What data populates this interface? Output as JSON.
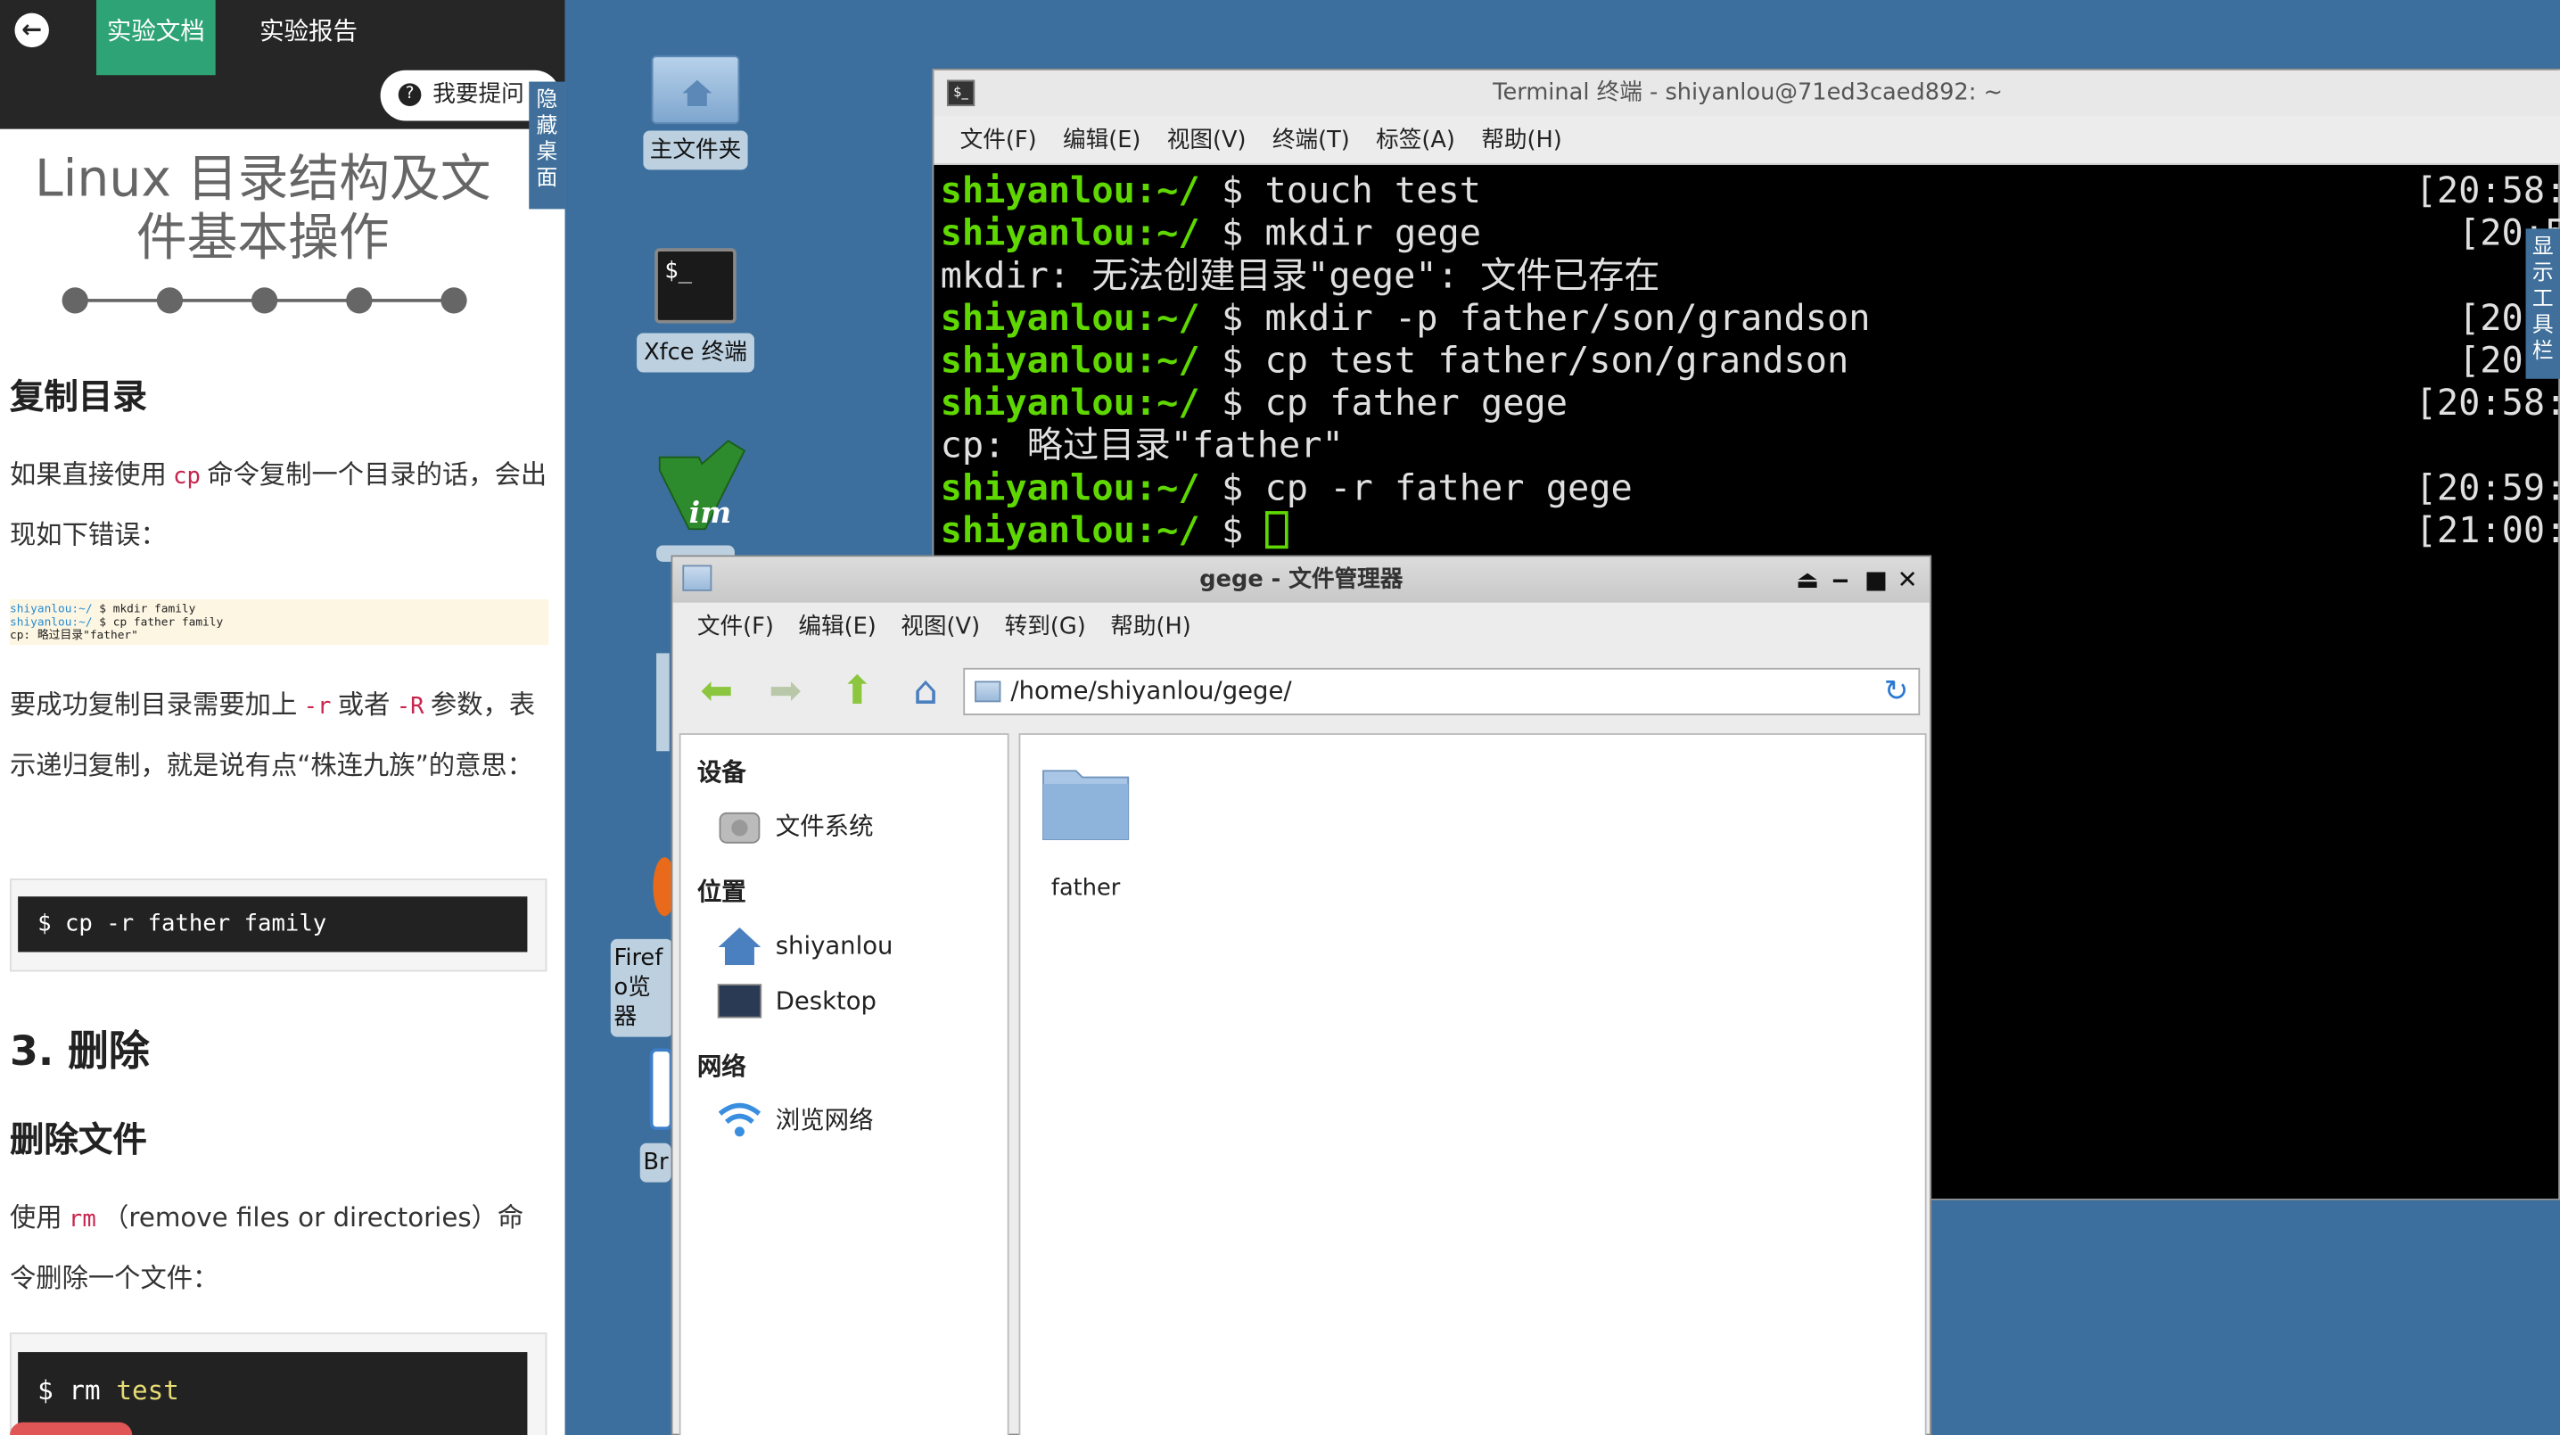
{
  "left_panel": {
    "header": {
      "tab_docs": "实验文档",
      "tab_report": "实验报告",
      "ask_button": "我要提问",
      "hide_desktop": "隐藏桌面"
    },
    "title": "Linux 目录结构及文件基本操作",
    "section_copy_dir": "复制目录",
    "para1_a": "如果直接使用",
    "para1_code": "cp",
    "para1_b": "命令复制一个目录的话，会出现如下错误：",
    "mini_terminal": [
      {
        "prompt": "shiyanlou:~/",
        "cmd": " $ mkdir family"
      },
      {
        "prompt": "shiyanlou:~/",
        "cmd": " $ cp father family"
      },
      {
        "prompt": "",
        "cmd": "cp: 略过目录\"father\""
      }
    ],
    "para2_a": "要成功复制目录需要加上",
    "para2_code1": "-r",
    "para2_mid": "或者",
    "para2_code2": "-R",
    "para2_b": "参数，表示递归复制，就是说有点“株连九族”的意思：",
    "code1": "$ cp -r father family",
    "section_delete": "3. 删除",
    "section_delete_file": "删除文件",
    "para3_a": "使用",
    "para3_code": "rm",
    "para3_b": "（remove files or directories）命令删除一个文件：",
    "code2_prompt": "$ rm",
    "code2_arg": "test"
  },
  "desktop": {
    "icons": {
      "home_folder": "主文件夹",
      "xfce_terminal": "Xfce 终端",
      "firefox_partial": "Firefo览器",
      "br_partial": "Br"
    },
    "show_toolbar": "显示工具栏"
  },
  "terminal": {
    "title": "Terminal 终端 - shiyanlou@71ed3caed892: ~",
    "menu": [
      "文件(F)",
      "编辑(E)",
      "视图(V)",
      "终端(T)",
      "标签(A)",
      "帮助(H)"
    ],
    "lines": [
      {
        "prompt": "shiyanlou:~/",
        "text": " $ touch test",
        "time": "[20:58:"
      },
      {
        "prompt": "shiyanlou:~/",
        "text": " $ mkdir gege",
        "time": "[20:5"
      },
      {
        "prompt": "",
        "text": "mkdir: 无法创建目录\"gege\": 文件已存在",
        "time": ""
      },
      {
        "prompt": "shiyanlou:~/",
        "text": " $ mkdir -p father/son/grandson",
        "time": "[20:5"
      },
      {
        "prompt": "shiyanlou:~/",
        "text": " $ cp test father/son/grandson",
        "time": "[20:5"
      },
      {
        "prompt": "shiyanlou:~/",
        "text": " $ cp father gege",
        "time": "[20:58:"
      },
      {
        "prompt": "",
        "text": "cp: 略过目录\"father\"",
        "time": ""
      },
      {
        "prompt": "shiyanlou:~/",
        "text": " $ cp -r father gege",
        "time": "[20:59:"
      },
      {
        "prompt": "shiyanlou:~/",
        "text": " $ ",
        "time": "[21:00:"
      }
    ]
  },
  "file_manager": {
    "title": "gege - 文件管理器",
    "menu": [
      "文件(F)",
      "编辑(E)",
      "视图(V)",
      "转到(G)",
      "帮助(H)"
    ],
    "address": "/home/shiyanlou/gege/",
    "sidebar": {
      "devices_header": "设备",
      "filesystem": "文件系统",
      "places_header": "位置",
      "home": "shiyanlou",
      "desktop": "Desktop",
      "network_header": "网络",
      "browse_network": "浏览网络"
    },
    "items": [
      {
        "name": "father"
      }
    ]
  }
}
